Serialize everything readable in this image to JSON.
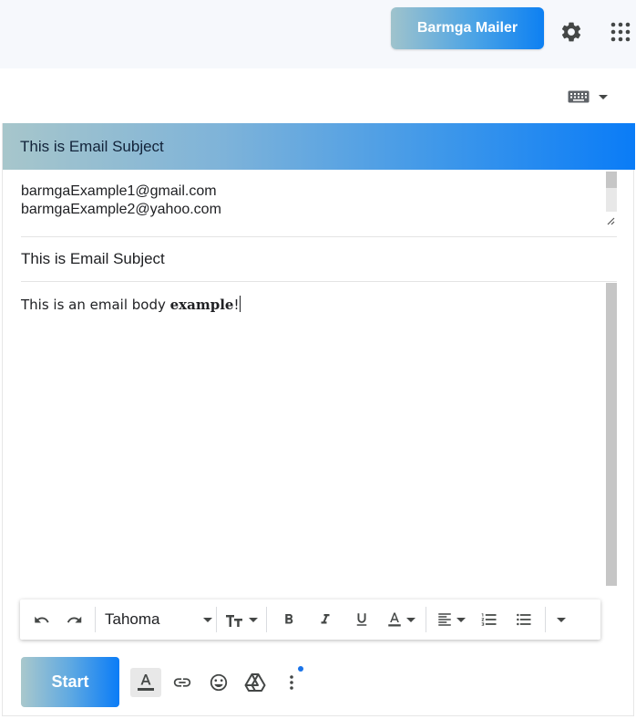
{
  "topbar": {
    "brand_button_label": "Barmga Mailer",
    "settings_icon": "gear-icon",
    "apps_icon": "apps-grid-icon"
  },
  "keyboard": {
    "icon": "keyboard-icon"
  },
  "panel": {
    "header_title": "This is Email Subject",
    "recipients": "barmgaExample1@gmail.com\nbarmgaExample2@yahoo.com",
    "subject": "This is Email Subject",
    "body_text_start": "This is an email body ",
    "body_text_bold": "example",
    "body_text_end": "!"
  },
  "toolbar": {
    "font": "Tahoma",
    "icons": [
      "undo-icon",
      "redo-icon",
      "text-size-icon",
      "bold-icon",
      "italic-icon",
      "underline-icon",
      "text-color-icon",
      "align-icon",
      "numbered-list-icon",
      "bulleted-list-icon",
      "more-formatting-icon"
    ]
  },
  "actions": {
    "start_label": "Start",
    "icons": [
      "formatting-options-icon",
      "link-icon",
      "emoji-icon",
      "drive-icon",
      "more-options-icon"
    ]
  },
  "colors": {
    "accent": "#0a7cf7",
    "header_text": "#12233a",
    "notification_dot": "#1a73e8"
  }
}
